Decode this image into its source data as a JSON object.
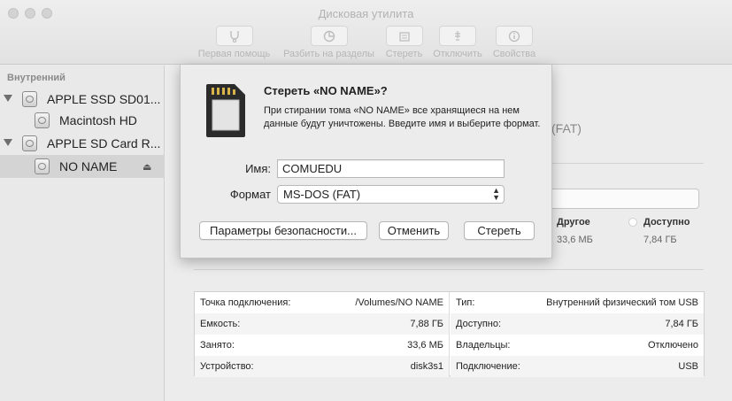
{
  "window": {
    "title": "Дисковая утилита"
  },
  "toolbar": {
    "items": [
      {
        "label": "Первая помощь",
        "icon": "stethoscope-icon"
      },
      {
        "label": "Разбить на разделы",
        "icon": "partition-pie-icon"
      },
      {
        "label": "Стереть",
        "icon": "erase-icon"
      },
      {
        "label": "Отключить",
        "icon": "unmount-icon"
      },
      {
        "label": "Свойства",
        "icon": "info-icon"
      }
    ]
  },
  "sidebar": {
    "section": "Внутренний",
    "items": [
      {
        "label": "APPLE SSD SD01...",
        "icon": "disk-icon"
      },
      {
        "label": "Macintosh HD",
        "icon": "volume-icon"
      },
      {
        "label": "APPLE SD Card R...",
        "icon": "disk-icon"
      },
      {
        "label": "NO NAME",
        "icon": "volume-icon",
        "selected": true,
        "eject": "⏏"
      }
    ]
  },
  "main": {
    "format_fragment": "(FAT)",
    "legend": [
      {
        "label": "Другое",
        "value": "33,6 МБ"
      },
      {
        "label": "Доступно",
        "value": "7,84 ГБ"
      }
    ],
    "info_left": [
      {
        "key": "Точка подключения:",
        "value": "/Volumes/NO NAME"
      },
      {
        "key": "Емкость:",
        "value": "7,88 ГБ"
      },
      {
        "key": "Занято:",
        "value": "33,6 МБ"
      },
      {
        "key": "Устройство:",
        "value": "disk3s1"
      }
    ],
    "info_right": [
      {
        "key": "Тип:",
        "value": "Внутренний физический том USB"
      },
      {
        "key": "Доступно:",
        "value": "7,84 ГБ"
      },
      {
        "key": "Владельцы:",
        "value": "Отключено"
      },
      {
        "key": "Подключение:",
        "value": "USB"
      }
    ]
  },
  "dialog": {
    "title": "Стереть «NO NAME»?",
    "message": "При стирании тома «NO NAME» все хранящиеся на нем данные будут уничтожены. Введите имя и выберите формат.",
    "name_label": "Имя:",
    "name_value": "COMUEDU",
    "format_label": "Формат",
    "format_value": "MS-DOS (FAT)",
    "buttons": {
      "security": "Параметры безопасности...",
      "cancel": "Отменить",
      "erase": "Стереть"
    }
  }
}
